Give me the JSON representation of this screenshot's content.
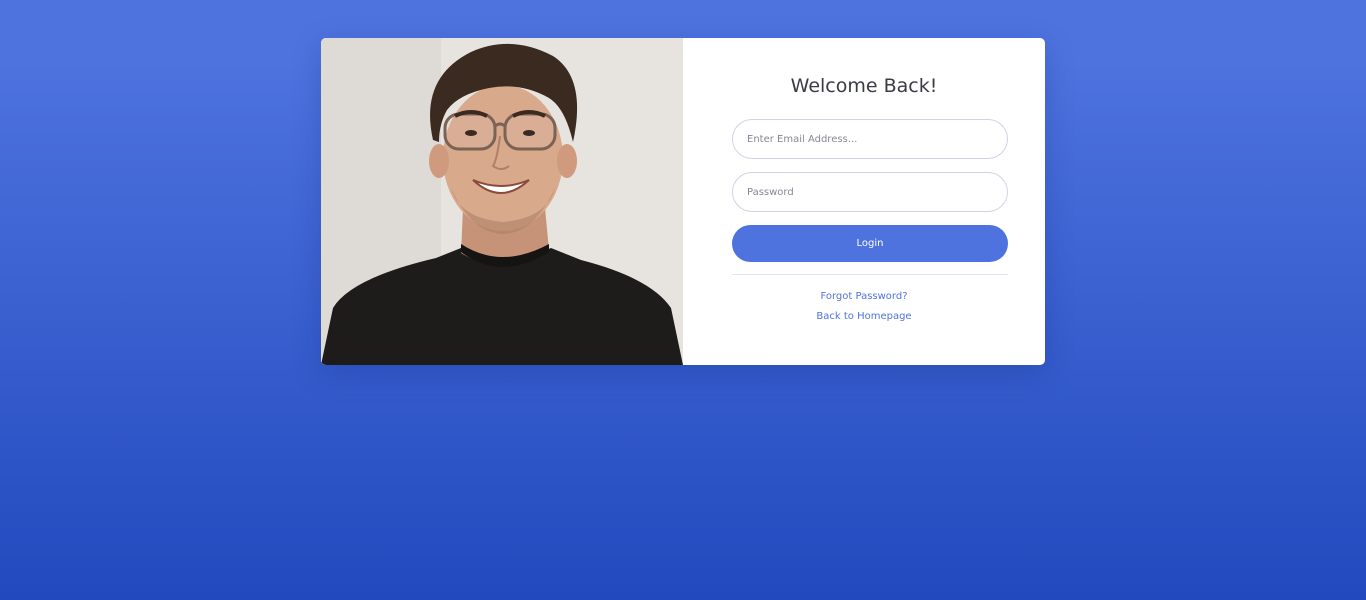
{
  "login": {
    "title": "Welcome Back!",
    "email_placeholder": "Enter Email Address...",
    "password_placeholder": "Password",
    "login_label": "Login",
    "forgot_password_label": "Forgot Password?",
    "back_home_label": "Back to Homepage"
  },
  "colors": {
    "background_top": "#4e73df",
    "background_bottom": "#224abe",
    "accent": "#4e73df",
    "card": "#ffffff"
  }
}
